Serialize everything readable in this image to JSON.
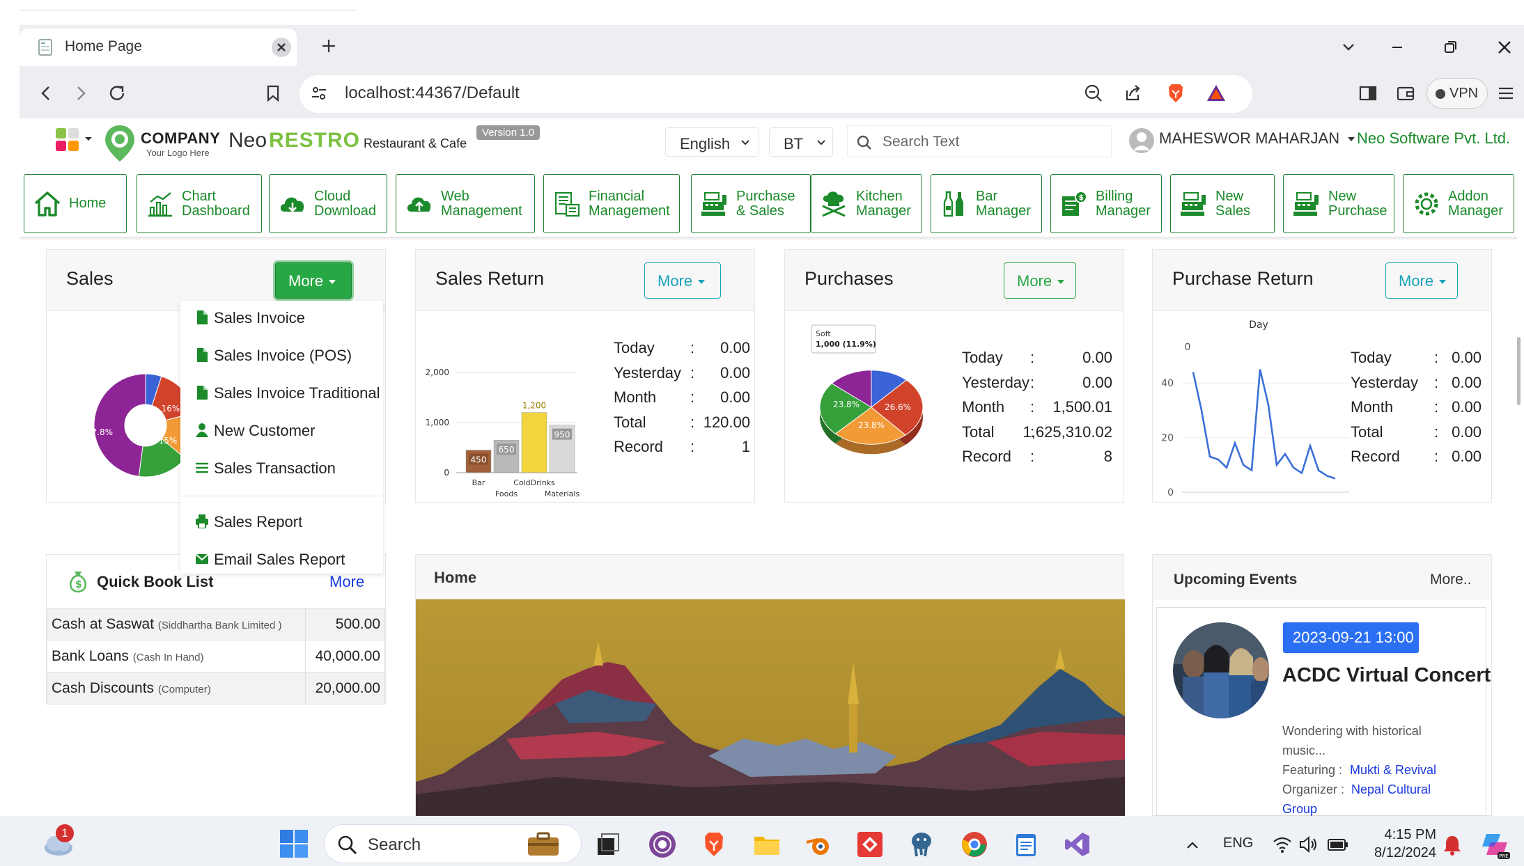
{
  "browser": {
    "tab_title": "Home Page",
    "url": "localhost:44367/Default",
    "vpn_label": "VPN"
  },
  "appbar": {
    "company": "COMPANY",
    "logo_tagline": "Your Logo Here",
    "brand_neo": "Neo",
    "brand_restro": "RESTRO",
    "brand_sub": "Restaurant & Cafe",
    "version": "Version 1.0",
    "language": "English",
    "bt": "BT",
    "search_placeholder": "Search Text",
    "user": "MAHESWOR MAHARJAN",
    "org": "Neo Software Pvt. Ltd."
  },
  "nav": [
    {
      "label": "Home",
      "icon": "house-icon"
    },
    {
      "label": "Chart\nDashboard",
      "icon": "chart-icon"
    },
    {
      "label": "Cloud\nDownload",
      "icon": "cloud-download-icon"
    },
    {
      "label": "Web\nManagement",
      "icon": "cloud-upload-icon"
    },
    {
      "label": "Financial\nManagement",
      "icon": "ledger-icon"
    },
    {
      "label": "Purchase\n& Sales",
      "icon": "register-icon"
    },
    {
      "label": "Kitchen\nManager",
      "icon": "chef-icon"
    },
    {
      "label": "Bar\nManager",
      "icon": "bottles-icon"
    },
    {
      "label": "Billing\nManager",
      "icon": "billing-icon"
    },
    {
      "label": "New\nSales",
      "icon": "register-icon"
    },
    {
      "label": "New\nPurchase",
      "icon": "register-icon"
    },
    {
      "label": "Addon\nManager",
      "icon": "gear-icon"
    }
  ],
  "cards": {
    "more_label": "More",
    "sales": {
      "title": "Sales"
    },
    "sales_return": {
      "title": "Sales Return",
      "stats": [
        {
          "label": "Today",
          "sep": ":",
          "value": "0.00"
        },
        {
          "label": "Yesterday",
          "sep": ":",
          "value": "0.00"
        },
        {
          "label": "Month",
          "sep": ":",
          "value": "0.00"
        },
        {
          "label": "Total",
          "sep": ":",
          "value": "120.00"
        },
        {
          "label": "Record",
          "sep": ":",
          "value": "1"
        }
      ]
    },
    "purchases": {
      "title": "Purchases",
      "stats": [
        {
          "label": "Today",
          "sep": ":",
          "value": "0.00"
        },
        {
          "label": "Yesterday",
          "sep": ":",
          "value": "0.00"
        },
        {
          "label": "Month",
          "sep": ":",
          "value": "1,500.01"
        },
        {
          "label": "Total",
          "sep": ":",
          "value": "1,625,310.02"
        },
        {
          "label": "Record",
          "sep": ":",
          "value": "8"
        }
      ]
    },
    "purchase_return": {
      "title": "Purchase Return",
      "stats": [
        {
          "label": "Today",
          "sep": ":",
          "value": "0.00"
        },
        {
          "label": "Yesterday",
          "sep": ":",
          "value": "0.00"
        },
        {
          "label": "Month",
          "sep": ":",
          "value": "0.00"
        },
        {
          "label": "Total",
          "sep": ":",
          "value": "0.00"
        },
        {
          "label": "Record",
          "sep": ":",
          "value": "0.00"
        }
      ]
    }
  },
  "sales_dropdown": [
    {
      "label": "Sales Invoice",
      "icon": "file-icon"
    },
    {
      "label": "Sales Invoice (POS)",
      "icon": "file-icon"
    },
    {
      "label": "Sales Invoice Traditional",
      "icon": "file-icon"
    },
    {
      "label": "New Customer",
      "icon": "user-icon"
    },
    {
      "label": "Sales Transaction",
      "icon": "list-icon"
    },
    {
      "label": "Sales Report",
      "icon": "printer-icon"
    },
    {
      "label": "Email Sales Report",
      "icon": "envelope-icon"
    }
  ],
  "quick_book": {
    "title": "Quick Book List",
    "more": "More",
    "rows": [
      {
        "name": "Cash at Saswat",
        "note": "(Siddhartha Bank Limited )",
        "amount": "500.00"
      },
      {
        "name": "Bank Loans",
        "note": "(Cash In Hand)",
        "amount": "40,000.00"
      },
      {
        "name": "Cash Discounts",
        "note": "(Computer)",
        "amount": "20,000.00"
      }
    ]
  },
  "home_panel": {
    "title": "Home"
  },
  "events": {
    "title": "Upcoming Events",
    "more": "More..",
    "date": "2023-09-21 13:00",
    "name": "ACDC Virtual Concert",
    "desc1": "Wondering with historical",
    "desc2": "music...",
    "featuring_label": "Featuring :",
    "featuring": "Mukti & Revival",
    "organizer_label": "Organizer :",
    "organizer1": "Nepal Cultural",
    "organizer2": "Group"
  },
  "taskbar": {
    "search": "Search",
    "badge": "1",
    "lang": "ENG",
    "time": "4:15 PM",
    "date": "8/12/2024"
  },
  "chart_data": [
    {
      "type": "pie",
      "chart": "sales",
      "labels": [
        "16%",
        "15%",
        "47.8%"
      ],
      "values": [
        5,
        16,
        15,
        16,
        47.8
      ],
      "colors": [
        "#3a63d6",
        "#d2432c",
        "#f29a36",
        "#36a03a",
        "#8e2596"
      ]
    },
    {
      "type": "bar",
      "chart": "sales_return",
      "categories": [
        "Bar",
        "Foods",
        "ColdDrinks",
        "Materials"
      ],
      "values": [
        450,
        650,
        1200,
        950
      ],
      "value_labels": [
        "450",
        "650",
        "1,200",
        "950"
      ],
      "colors": [
        "#a0603a",
        "#b9b9b9",
        "#f2d53c",
        "#d9d9d9"
      ],
      "yticks": [
        "0",
        "1,000",
        "2,000"
      ],
      "ylim": [
        0,
        2000
      ]
    },
    {
      "type": "pie",
      "chart": "purchases",
      "labels": [
        "26.6%",
        "23.8%",
        "23.8%"
      ],
      "values": [
        11.9,
        26.6,
        23.8,
        23.8,
        13.9
      ],
      "colors": [
        "#3a63d6",
        "#d2432c",
        "#f29a36",
        "#36a03a",
        "#8e2596"
      ],
      "tooltip_title": "Soft",
      "tooltip_value": "1,000 (11.9%)"
    },
    {
      "type": "line",
      "chart": "purchase_return",
      "title": "Day",
      "yticks": [
        "0",
        "20",
        "40"
      ],
      "top_tick": "0",
      "ylim": [
        0,
        50
      ],
      "values": [
        44,
        30,
        13,
        12,
        9,
        18,
        10,
        8,
        45,
        32,
        10,
        14,
        9,
        7,
        17,
        8,
        6,
        5
      ]
    }
  ]
}
